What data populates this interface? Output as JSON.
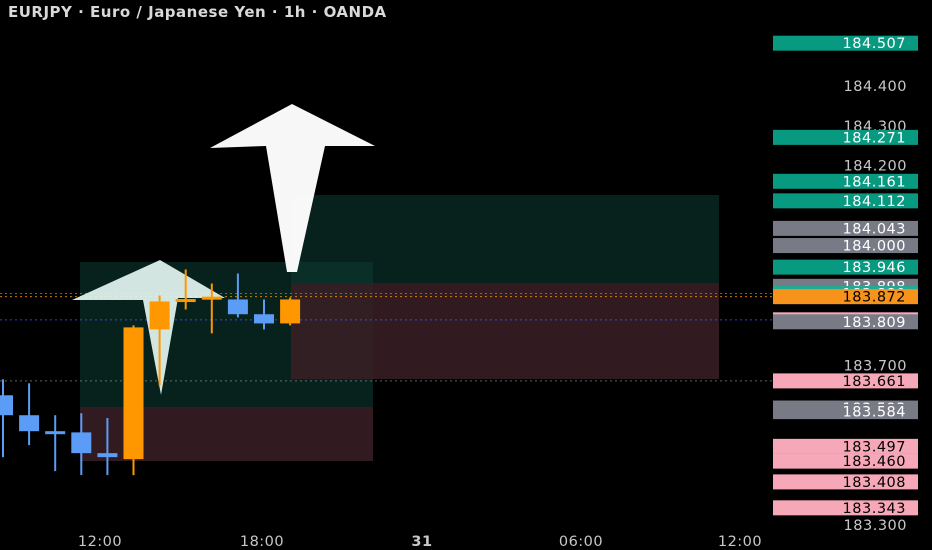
{
  "chart_data": {
    "type": "candlestick",
    "title": "EURJPY · Euro / Japanese Yen · 1h · OANDA",
    "ylim": [
      183.3,
      184.53
    ],
    "x_tick_labels": [
      "12:00",
      "18:00",
      "31",
      "06:00",
      "12:00"
    ],
    "y_tick_labels": [
      "184.400",
      "184.300",
      "184.200",
      "183.700",
      "183.300"
    ],
    "candles": [
      {
        "open": 183.625,
        "close": 183.575,
        "high": 183.665,
        "low": 183.47
      },
      {
        "open": 183.575,
        "close": 183.535,
        "high": 183.655,
        "low": 183.5
      },
      {
        "open": 183.535,
        "close": 183.532,
        "high": 183.575,
        "low": 183.435
      },
      {
        "open": 183.532,
        "close": 183.48,
        "high": 183.58,
        "low": 183.425
      },
      {
        "open": 183.48,
        "close": 183.47,
        "high": 183.568,
        "low": 183.425
      },
      {
        "open": 183.465,
        "close": 183.795,
        "high": 183.8,
        "low": 183.425
      },
      {
        "open": 183.79,
        "close": 183.86,
        "high": 183.875,
        "low": 183.65
      },
      {
        "open": 183.86,
        "close": 183.866,
        "high": 183.94,
        "low": 183.84
      },
      {
        "open": 183.866,
        "close": 183.872,
        "high": 183.905,
        "low": 183.78
      },
      {
        "open": 183.865,
        "close": 183.828,
        "high": 183.93,
        "low": 183.82
      },
      {
        "open": 183.828,
        "close": 183.805,
        "high": 183.865,
        "low": 183.79
      },
      {
        "open": 183.805,
        "close": 183.865,
        "high": 183.87,
        "low": 183.8
      }
    ],
    "badges": [
      {
        "value": "184.507",
        "color": "#089981"
      },
      {
        "value": "184.271",
        "color": "#089981"
      },
      {
        "value": "184.161",
        "color": "#089981"
      },
      {
        "value": "184.112",
        "color": "#089981"
      },
      {
        "value": "184.043",
        "color": "#787b86"
      },
      {
        "value": "184.000",
        "color": "#787b86"
      },
      {
        "value": "183.946",
        "color": "#089981"
      },
      {
        "value": "183.898",
        "color": "#787b86"
      },
      {
        "value": "183.880",
        "color": "#22ab94"
      },
      {
        "value": "183.872",
        "color": "#f7931a"
      },
      {
        "value": "183.814",
        "color": "#f7a8b8"
      },
      {
        "value": "183.809",
        "color": "#787b86"
      },
      {
        "value": "183.661",
        "color": "#f7a8b8"
      },
      {
        "value": "183.593",
        "color": "#787b86"
      },
      {
        "value": "183.584",
        "color": "#787b86"
      },
      {
        "value": "183.497",
        "color": "#f7a8b8"
      },
      {
        "value": "183.460",
        "color": "#f7a8b8"
      },
      {
        "value": "183.408",
        "color": "#f7a8b8"
      },
      {
        "value": "183.343",
        "color": "#f7a8b8"
      }
    ],
    "colors": {
      "up": "#ff9800",
      "down": "#5b9cf6",
      "background": "#000000"
    }
  }
}
